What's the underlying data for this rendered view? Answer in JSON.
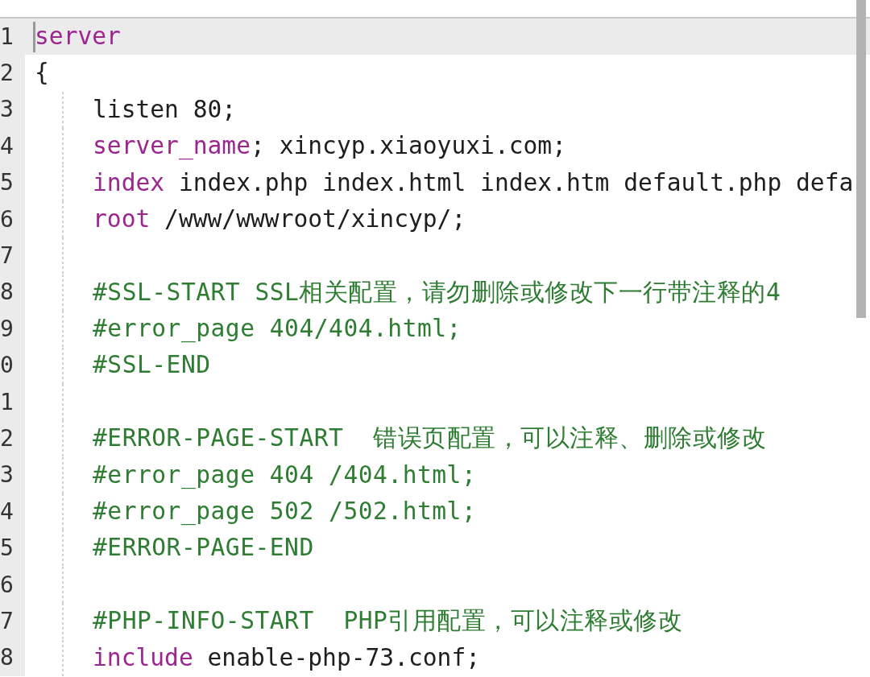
{
  "editor": {
    "lines": [
      {
        "number": "1",
        "selected": true,
        "tokens": [
          {
            "kind": "keyword",
            "text": "server"
          }
        ]
      },
      {
        "number": "2",
        "selected": false,
        "tokens": [
          {
            "kind": "plain",
            "text": "{"
          }
        ],
        "children": [
          {
            "number": "3",
            "selected": false,
            "tokens": [
              {
                "kind": "plain",
                "text": "listen 80;"
              }
            ]
          },
          {
            "number": "4",
            "selected": false,
            "tokens": [
              {
                "kind": "keyword",
                "text": "server_name"
              },
              {
                "kind": "plain",
                "text": "; xincyp.xiaoyuxi.com;"
              }
            ]
          },
          {
            "number": "5",
            "selected": false,
            "tokens": [
              {
                "kind": "keyword",
                "text": "index"
              },
              {
                "kind": "plain",
                "text": " index.php index.html index.htm default.php defa"
              }
            ]
          },
          {
            "number": "6",
            "selected": false,
            "tokens": [
              {
                "kind": "keyword",
                "text": "root"
              },
              {
                "kind": "plain",
                "text": " /www/wwwroot/xincyp/;"
              }
            ]
          },
          {
            "number": "7",
            "selected": false
          },
          {
            "number": "8",
            "selected": false,
            "tokens": [
              {
                "kind": "comment",
                "text": "#SSL-START SSL相关配置，请勿删除或修改下一行带注释的4"
              }
            ]
          },
          {
            "number": "9",
            "selected": false,
            "tokens": [
              {
                "kind": "comment",
                "text": "#error_page 404/404.html;"
              }
            ]
          },
          {
            "number": "0",
            "selected": false,
            "tokens": [
              {
                "kind": "comment",
                "text": "#SSL-END"
              }
            ]
          },
          {
            "number": "1",
            "selected": false
          },
          {
            "number": "2",
            "selected": false,
            "tokens": [
              {
                "kind": "comment",
                "text": "#ERROR-PAGE-START  错误页配置，可以注释、删除或修改"
              }
            ]
          },
          {
            "number": "3",
            "selected": false,
            "tokens": [
              {
                "kind": "comment",
                "text": "#error_page 404 /404.html;"
              }
            ]
          },
          {
            "number": "4",
            "selected": false,
            "tokens": [
              {
                "kind": "comment",
                "text": "#error_page 502 /502.html;"
              }
            ]
          },
          {
            "number": "5",
            "selected": false,
            "tokens": [
              {
                "kind": "comment",
                "text": "#ERROR-PAGE-END"
              }
            ]
          },
          {
            "number": "6",
            "selected": false
          },
          {
            "number": "7",
            "selected": false,
            "tokens": [
              {
                "kind": "comment",
                "text": "#PHP-INFO-START  PHP引用配置，可以注释或修改"
              }
            ]
          },
          {
            "number": "8",
            "selected": false,
            "tokens": [
              {
                "kind": "keyword",
                "text": "include"
              },
              {
                "kind": "plain",
                "text": " enable-php-73.conf;"
              }
            ]
          }
        ]
      }
    ]
  }
}
